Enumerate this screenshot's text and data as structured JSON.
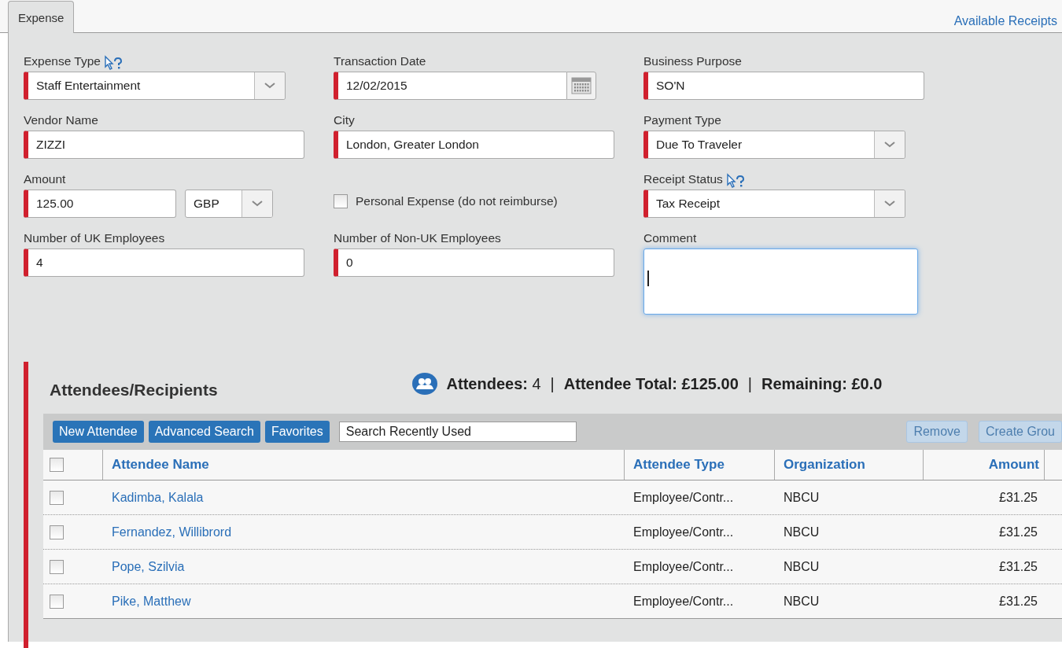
{
  "tabs": [
    {
      "label": "Expense",
      "selected": true
    }
  ],
  "receipts_link": "Available Receipts",
  "form": {
    "fields": [
      {
        "kind": "select",
        "label": "Expense Type",
        "help": true,
        "value": "Staff Entertainment",
        "required": true
      },
      {
        "kind": "date",
        "label": "Transaction Date",
        "value": "12/02/2015",
        "required": true
      },
      {
        "kind": "text",
        "label": "Business Purpose",
        "value": "SO'N",
        "required": true
      },
      {
        "kind": "text",
        "label": "Vendor Name",
        "value": "ZIZZI",
        "required": true
      },
      {
        "kind": "text",
        "label": "City",
        "value": "London, Greater London",
        "required": true
      },
      {
        "kind": "select",
        "label": "Payment Type",
        "value": "Due To Traveler",
        "required": true
      },
      {
        "kind": "amount",
        "label": "Amount",
        "value": "125.00",
        "currency": "GBP",
        "required": true
      },
      {
        "kind": "checkbox",
        "label": "Personal Expense (do not reimburse)",
        "checked": false
      },
      {
        "kind": "select",
        "label": "Receipt Status",
        "help": true,
        "value": "Tax Receipt",
        "required": true
      },
      {
        "kind": "text",
        "label": "Number of UK Employees",
        "value": "4",
        "required": true
      },
      {
        "kind": "text",
        "label": "Number of Non-UK Employees",
        "value": "0",
        "required": true
      },
      {
        "kind": "textarea",
        "label": "Comment",
        "required": false,
        "focused": true
      }
    ]
  },
  "attendees": {
    "title": "Attendees/Recipients",
    "summary": [
      {
        "label": "Attendees:",
        "value": "4",
        "strong": false
      },
      {
        "separator": "|",
        "label": "Attendee Total:",
        "value": "£125.00",
        "strong": true
      },
      {
        "separator": "|",
        "label": "Remaining:",
        "value": "£0.0",
        "strong": true
      }
    ],
    "toolbar": {
      "buttons": [
        {
          "label": "New Attendee",
          "disabled": false
        },
        {
          "label": "Advanced Search",
          "disabled": false
        },
        {
          "label": "Favorites",
          "disabled": false
        }
      ],
      "search": {
        "placeholder": "Search Recently Used"
      },
      "right_buttons": [
        {
          "label": "Remove",
          "disabled": true
        },
        {
          "label": "Create Grou",
          "disabled": true
        }
      ]
    },
    "table": {
      "header_checked": false,
      "columns": [
        "Attendee Name",
        "Attendee Type",
        "Organization",
        "Amount"
      ],
      "rows": [
        {
          "checked": false,
          "name": "Kadimba, Kalala",
          "type": "Employee/Contr...",
          "organization": "NBCU",
          "amount": "£31.25"
        },
        {
          "checked": false,
          "name": "Fernandez, Willibrord",
          "type": "Employee/Contr...",
          "organization": "NBCU",
          "amount": "£31.25"
        },
        {
          "checked": false,
          "name": "Pope, Szilvia",
          "type": "Employee/Contr...",
          "organization": "NBCU",
          "amount": "£31.25"
        },
        {
          "checked": false,
          "name": "Pike, Matthew",
          "type": "Employee/Contr...",
          "organization": "NBCU",
          "amount": "£31.25"
        }
      ]
    }
  }
}
